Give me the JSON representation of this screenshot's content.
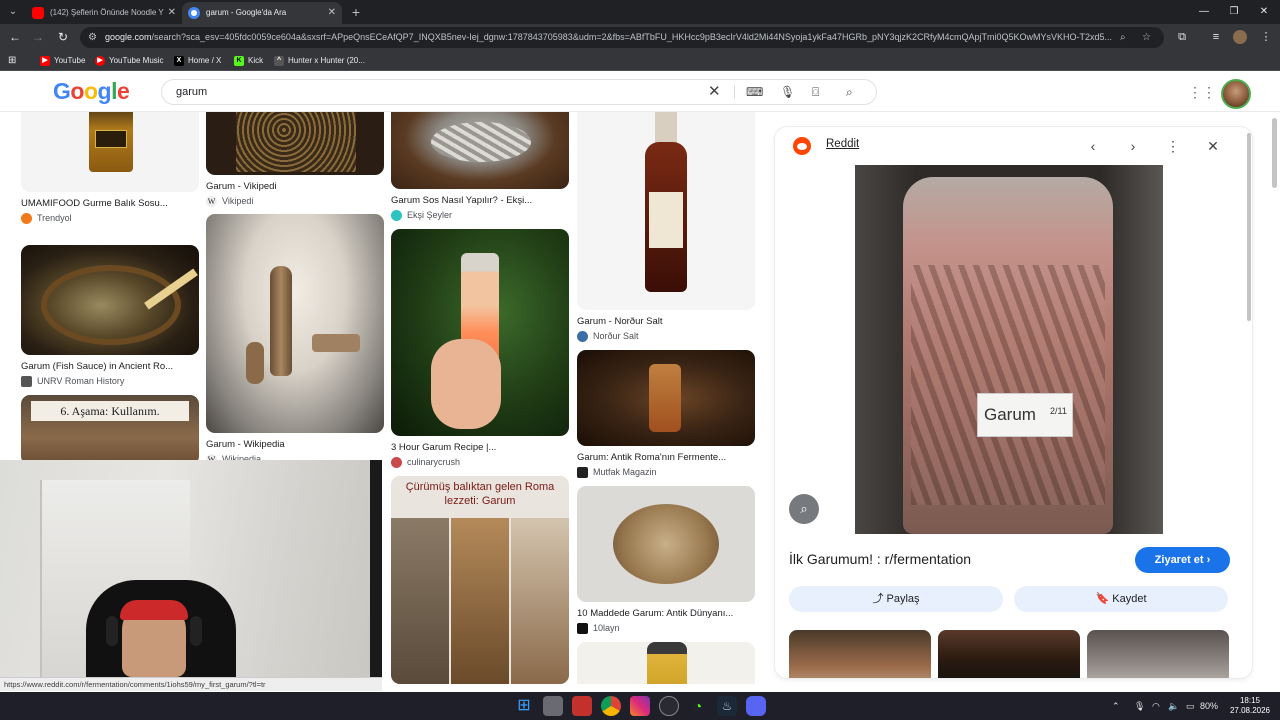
{
  "browser": {
    "tabs": [
      {
        "label": "(142) Şeflerin Önünde Noodle Y",
        "favicon_color": "#ff0000",
        "active": false
      },
      {
        "label": "garum - Google'da Ara",
        "favicon_color": "#4285f4",
        "active": true
      }
    ],
    "url_host": "google.com",
    "url_rest": "/search?sca_esv=405fdc0059ce604a&sxsrf=APpeQnsECeAfQP7_INQXB5nev-Iej_dgnw:1787843705983&udm=2&fbs=ABfTbFU_HKHcc9pB3ecIrV4ld2Mi44NSyoja1ykFa47HGRb_pNY3qjzK2CRfyM4cmQApjTmi0Q5KOwMYsVKHO-T2xd5...",
    "bookmarks": [
      {
        "label": "YouTube",
        "icon": "youtube-icon",
        "color": "#ff0000"
      },
      {
        "label": "YouTube Music",
        "icon": "youtube-music-icon",
        "color": "#ff0000"
      },
      {
        "label": "Home / X",
        "icon": "x-icon",
        "color": "#000000"
      },
      {
        "label": "Kick",
        "icon": "kick-icon",
        "color": "#53fc18"
      },
      {
        "label": "Hunter x Hunter (20...",
        "icon": "hunter-icon",
        "color": "#444444"
      }
    ]
  },
  "google": {
    "logo": "Google",
    "query": "garum"
  },
  "results": [
    {
      "title": "UMAMIFOOD Gurme Balık Sosu...",
      "source": "Trendyol",
      "source_color": "#f27a1a"
    },
    {
      "title": "Garum (Fish Sauce) in Ancient Ro...",
      "source": "UNRV Roman History",
      "source_color": "#555555"
    },
    {
      "overlay_text": "6. Aşama: Kullanım."
    },
    {
      "title": "Garum - Vikipedi",
      "source": "Vikipedi",
      "source_color": "#333333"
    },
    {
      "title": "Garum - Wikipedia",
      "source": "Wikipedia",
      "source_color": "#333333"
    },
    {
      "title": "Garum Sos Nasıl Yapılır? - Ekşi...",
      "source": "Ekşi Şeyler",
      "source_color": "#2cc3c1"
    },
    {
      "title": "3 Hour Garum Recipe |...",
      "source": "culinarycrush",
      "source_color": "#c94a4a"
    },
    {
      "overlay_text": "Çürümüş balıktan gelen Roma lezzeti: Garum"
    },
    {
      "title": "Garum - Norður Salt",
      "source": "Norður Salt",
      "source_color": "#3a6ea5"
    },
    {
      "title": "Garum: Antik Roma'nın Fermente...",
      "source": "Mutfak Magazin",
      "source_color": "#222222"
    },
    {
      "title": "10 Maddede Garum: Antik Dünyanı...",
      "source": "10layn",
      "source_color": "#111111"
    }
  ],
  "panel": {
    "site": "Reddit",
    "title": "İlk Garumum! : r/fermentation",
    "label_text": "Garum",
    "label_fraction": "2/11",
    "visit": "Ziyaret et",
    "share": "Paylaş",
    "save": "Kaydet"
  },
  "status_url": "https://www.reddit.com/r/fermentation/comments/1iohs59/my_first_garum/?tl=tr",
  "system": {
    "battery": "80%",
    "time": "18:15",
    "date": "27.08.2026"
  }
}
